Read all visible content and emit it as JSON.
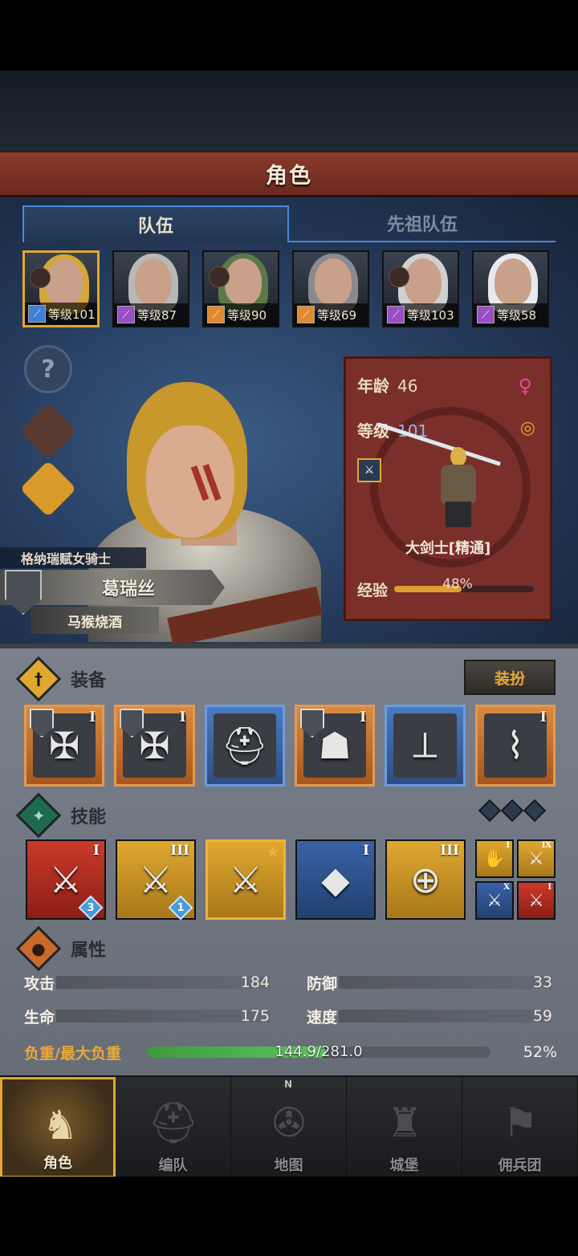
{
  "header": {
    "title": "角色"
  },
  "tabs": [
    {
      "label": "队伍",
      "active": true
    },
    {
      "label": "先祖队伍",
      "active": false
    }
  ],
  "roster": [
    {
      "level_label": "等级101",
      "hair": "#d4a73a",
      "selected": true,
      "class_color": "#3f7fd6",
      "merc": true
    },
    {
      "level_label": "等级87",
      "hair": "#b8b8b8",
      "selected": false,
      "class_color": "#9a4ec6",
      "merc": false
    },
    {
      "level_label": "等级90",
      "hair": "#5a7a4a",
      "selected": false,
      "class_color": "#e08a30",
      "merc": true
    },
    {
      "level_label": "等级69",
      "hair": "#8a8a90",
      "selected": false,
      "class_color": "#e08a30",
      "merc": false
    },
    {
      "level_label": "等级103",
      "hair": "#d0d0d0",
      "selected": false,
      "class_color": "#9a4ec6",
      "merc": true
    },
    {
      "level_label": "等级58",
      "hair": "#e8e8ee",
      "selected": false,
      "class_color": "#9a4ec6",
      "merc": false
    }
  ],
  "character": {
    "subtitle": "格纳瑞赋女骑士",
    "name": "葛瑞丝",
    "trait": "马猴烧酒",
    "age_label": "年龄",
    "age": "46",
    "level_label": "等级",
    "level": "101",
    "class_name": "大剑士[精通]",
    "exp_label": "经验",
    "exp_text": "48%",
    "exp_fraction": 0.48
  },
  "equipment": {
    "title": "装备",
    "dress_button": "装扮",
    "slots": [
      {
        "tier": "I",
        "rarity": "orange",
        "crest": true,
        "glyph": "✠"
      },
      {
        "tier": "I",
        "rarity": "orange",
        "crest": true,
        "glyph": "✠"
      },
      {
        "tier": "",
        "rarity": "blue",
        "crest": false,
        "glyph": "⛑"
      },
      {
        "tier": "I",
        "rarity": "orange",
        "crest": true,
        "glyph": "☗"
      },
      {
        "tier": "",
        "rarity": "blue",
        "crest": false,
        "glyph": "⟂"
      },
      {
        "tier": "I",
        "rarity": "orange",
        "crest": false,
        "glyph": "⌇"
      }
    ]
  },
  "skills": {
    "title": "技能",
    "items": [
      {
        "tier": "I",
        "color": "red",
        "glyph": "⚔",
        "gem": "3",
        "star": false
      },
      {
        "tier": "III",
        "color": "gold",
        "glyph": "⚔",
        "gem": "1",
        "star": false
      },
      {
        "tier": "",
        "color": "gold",
        "glyph": "⚔",
        "gem": "",
        "star": true
      },
      {
        "tier": "I",
        "color": "blue",
        "glyph": "◆",
        "gem": "",
        "star": false
      },
      {
        "tier": "III",
        "color": "gold",
        "glyph": "⊕",
        "gem": "",
        "star": false
      }
    ],
    "mini": [
      {
        "tier": "I",
        "color": "gold",
        "glyph": "✋"
      },
      {
        "tier": "IX",
        "color": "gold",
        "glyph": "⚔"
      },
      {
        "tier": "X",
        "color": "blue",
        "glyph": "⚔"
      },
      {
        "tier": "I",
        "color": "red",
        "glyph": "⚔"
      }
    ]
  },
  "attributes": {
    "title": "属性",
    "attack_label": "攻击",
    "attack": "184",
    "defense_label": "防御",
    "defense": "33",
    "hp_label": "生命",
    "hp": "175",
    "speed_label": "速度",
    "speed": "59",
    "load_label": "负重/最大负重",
    "load_text": "144.9/281.0",
    "load_pct": "52%",
    "load_fraction": 0.52
  },
  "nav": [
    {
      "label": "角色",
      "active": true,
      "icon": "knight-icon"
    },
    {
      "label": "编队",
      "active": false,
      "icon": "helmet-icon"
    },
    {
      "label": "地图",
      "active": false,
      "icon": "compass-icon"
    },
    {
      "label": "城堡",
      "active": false,
      "icon": "castle-icon"
    },
    {
      "label": "佣兵团",
      "active": false,
      "icon": "banner-icon"
    }
  ],
  "compass_n": "N",
  "colors": {
    "accent": "#e0a830",
    "title_bar": "#7a3426",
    "tab_border": "#4f86d6"
  }
}
